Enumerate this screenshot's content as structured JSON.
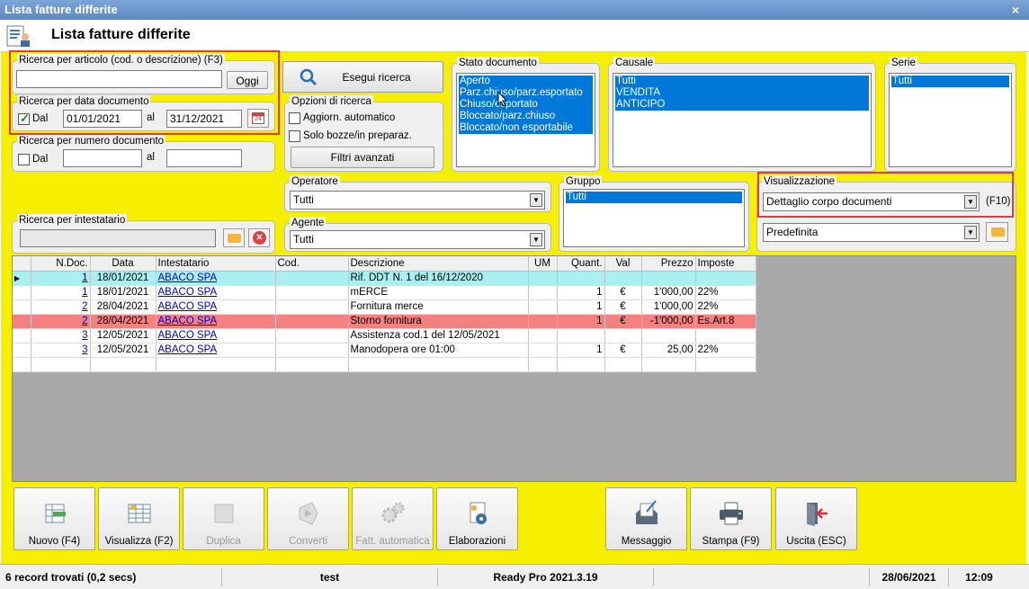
{
  "window": {
    "title": "Lista fatture differite",
    "close": "×"
  },
  "header": {
    "title": "Lista fatture differite"
  },
  "search_article": {
    "label": "Ricerca per articolo (cod. o descrizione) (F3)",
    "value": "",
    "today_button": "Oggi"
  },
  "search_date": {
    "label": "Ricerca per data documento",
    "checkbox_label": "Dal",
    "from": "01/01/2021",
    "al": "al",
    "to": "31/12/2021",
    "calendar_day": "24"
  },
  "search_number": {
    "label": "Ricerca per numero documento",
    "checkbox_label": "Dal",
    "from": "",
    "al": "al",
    "to": ""
  },
  "search_holder": {
    "label": "Ricerca per intestatario",
    "value": ""
  },
  "run_search": {
    "label": "Esegui ricerca"
  },
  "search_options": {
    "label": "Opzioni di ricerca",
    "auto_update": "Aggiorn. automatico",
    "drafts_only": "Solo bozze/in preparaz.",
    "advanced": "Filtri avanzati"
  },
  "doc_status": {
    "label": "Stato documento",
    "items": [
      "Aperto",
      "Parz.chiuso/parz.esportato",
      "Chiuso/esportato",
      "Bloccato/parz.chiuso",
      "Bloccato/non esportabile"
    ]
  },
  "causale": {
    "label": "Causale",
    "items": [
      "Tutti",
      "VENDITA",
      "ANTICIPO"
    ]
  },
  "serie": {
    "label": "Serie",
    "items": [
      "Tutti"
    ]
  },
  "operator": {
    "label": "Operatore",
    "value": "Tutti"
  },
  "agent": {
    "label": "Agente",
    "value": "Tutti"
  },
  "group": {
    "label": "Gruppo",
    "items": [
      "Tutti"
    ]
  },
  "view": {
    "label": "Visualizzazione",
    "value": "Dettaglio corpo documenti",
    "shortcut": "(F10)",
    "preset": "Predefinita"
  },
  "table": {
    "columns": [
      "N.Doc.",
      "Data",
      "Intestatario",
      "Cod.",
      "Descrizione",
      "UM",
      "Quant.",
      "Val",
      "Prezzo",
      "Imposte"
    ],
    "rows": [
      {
        "ndoc": "1",
        "data": "18/01/2021",
        "intestatario": "ABACO SPA",
        "cod": "",
        "descrizione": "Rif. DDT N. 1 del 16/12/2020",
        "um": "",
        "quant": "",
        "val": "",
        "prezzo": "",
        "imposte": ""
      },
      {
        "ndoc": "1",
        "data": "18/01/2021",
        "intestatario": "ABACO SPA",
        "cod": "",
        "descrizione": "mERCE",
        "um": "",
        "quant": "1",
        "val": "€",
        "prezzo": "1'000,00",
        "imposte": "22%"
      },
      {
        "ndoc": "2",
        "data": "28/04/2021",
        "intestatario": "ABACO SPA",
        "cod": "",
        "descrizione": "Fornitura merce",
        "um": "",
        "quant": "1",
        "val": "€",
        "prezzo": "1'000,00",
        "imposte": "22%"
      },
      {
        "ndoc": "2",
        "data": "28/04/2021",
        "intestatario": "ABACO SPA",
        "cod": "",
        "descrizione": "Storno fornitura",
        "um": "",
        "quant": "1",
        "val": "€",
        "prezzo": "-1'000,00",
        "imposte": "Es.Art.8"
      },
      {
        "ndoc": "3",
        "data": "12/05/2021",
        "intestatario": "ABACO SPA",
        "cod": "",
        "descrizione": "Assistenza cod.1 del 12/05/2021",
        "um": "",
        "quant": "",
        "val": "",
        "prezzo": "",
        "imposte": ""
      },
      {
        "ndoc": "3",
        "data": "12/05/2021",
        "intestatario": "ABACO SPA",
        "cod": "",
        "descrizione": "Manodopera ore 01:00",
        "um": "",
        "quant": "1",
        "val": "€",
        "prezzo": "25,00",
        "imposte": "22%"
      }
    ]
  },
  "toolbar": {
    "new": "Nuovo (F4)",
    "view": "Visualizza (F2)",
    "duplicate": "Duplica",
    "convert": "Converti",
    "auto_invoice": "Fatt. automatica",
    "processing": "Elaborazioni",
    "message": "Messaggio",
    "print": "Stampa (F9)",
    "exit": "Uscita (ESC)"
  },
  "statusbar": {
    "records": "6 record trovati (0,2 secs)",
    "user": "test",
    "app": "Ready Pro 2021.3.19",
    "date": "28/06/2021",
    "time": "12:09"
  }
}
